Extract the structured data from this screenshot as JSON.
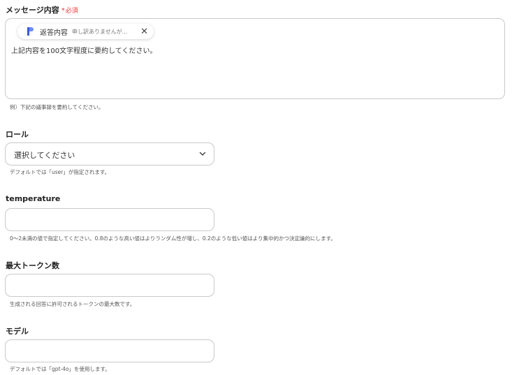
{
  "message": {
    "label": "メッセージ内容",
    "required_mark": "*",
    "required_text": "必須",
    "chip": {
      "title": "返答内容",
      "preview": "申し訳ありませんが...",
      "icon": "document-icon"
    },
    "value": "上記内容を100文字程度に要約してください。",
    "help": "例）下記の議事録を要約してください。"
  },
  "role": {
    "label": "ロール",
    "selected": "選択してください",
    "help": "デフォルトでは「user」が指定されます。"
  },
  "temperature": {
    "label": "temperature",
    "value": "",
    "help": "0〜2未満の値で指定してください。0.8のような高い値はよりランダム性が増し、0.2のような低い値はより集中的かつ決定論的にします。"
  },
  "max_tokens": {
    "label": "最大トークン数",
    "value": "",
    "help": "生成される回答に許可されるトークンの最大数です。"
  },
  "model": {
    "label": "モデル",
    "value": "",
    "help": "デフォルトでは「gpt-4o」を使用します。"
  },
  "colors": {
    "required": "#e53935",
    "border": "#c9c9c9",
    "chip_icon": "#3b5bdb"
  }
}
